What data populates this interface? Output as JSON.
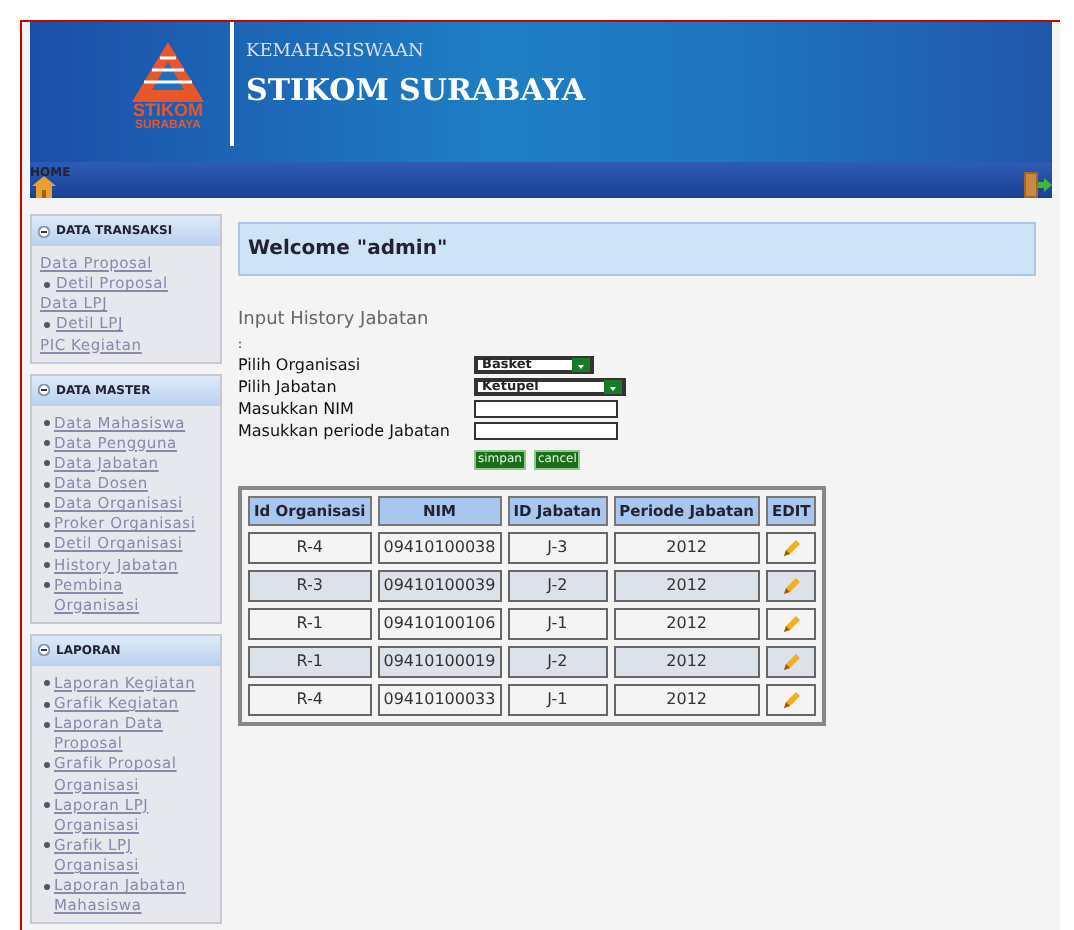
{
  "header": {
    "subtitle": "KEMAHASISWAAN",
    "title": "STIKOM SURABAYA",
    "logo_text": [
      "STIKOM",
      "SURABAYA"
    ]
  },
  "nav": {
    "home": "HOME"
  },
  "sidebar": [
    {
      "title": "DATA TRANSAKSI",
      "items": [
        {
          "label": "Data Proposal",
          "children": [
            {
              "label": "Detil Proposal"
            }
          ]
        },
        {
          "label": "Data LPJ",
          "children": [
            {
              "label": "Detil LPJ"
            }
          ]
        },
        {
          "label": "PIC Kegiatan"
        }
      ]
    },
    {
      "title": "DATA MASTER",
      "items": [
        {
          "label": "Data Mahasiswa",
          "kind": "bullet"
        },
        {
          "label": "Data Pengguna",
          "kind": "bullet"
        },
        {
          "label": "Data Jabatan",
          "kind": "bullet"
        },
        {
          "label": "Data Dosen",
          "kind": "bullet"
        },
        {
          "label": "Data Organisasi",
          "kind": "bullet"
        },
        {
          "label": "Proker Organisasi",
          "kind": "bullet"
        },
        {
          "label": "Detil Organisasi",
          "kind": "bullet"
        },
        {
          "label": "History Jabatan",
          "kind": "bullet"
        },
        {
          "label": "Pembina Organisasi",
          "kind": "bullet"
        }
      ]
    },
    {
      "title": "LAPORAN",
      "items": [
        {
          "label": "Laporan Kegiatan",
          "kind": "bullet"
        },
        {
          "label": "Grafik Kegiatan",
          "kind": "bullet"
        },
        {
          "label": "Laporan Data Proposal",
          "kind": "bullet"
        },
        {
          "label": "Grafik Proposal Organisasi",
          "kind": "bullet"
        },
        {
          "label": "Laporan LPJ Organisasi",
          "kind": "bullet"
        },
        {
          "label": "Grafik LPJ Organisasi",
          "kind": "bullet"
        },
        {
          "label": "Laporan Jabatan Mahasiswa",
          "kind": "bullet"
        }
      ]
    }
  ],
  "welcome": "Welcome \"admin\"",
  "form": {
    "title": "Input History Jabatan",
    "separator": ":",
    "fields": [
      {
        "label": "Pilih Organisasi",
        "kind": "select",
        "value": "Basket"
      },
      {
        "label": "Pilih Jabatan",
        "kind": "select",
        "value": "Ketupel"
      },
      {
        "label": "Masukkan NIM",
        "kind": "text"
      },
      {
        "label": "Masukkan periode Jabatan",
        "kind": "text"
      }
    ],
    "buttons": [
      "simpan",
      "cancel"
    ]
  },
  "table": {
    "columns": [
      "Id Organisasi",
      "NIM",
      "ID Jabatan",
      "Periode Jabatan",
      "EDIT"
    ],
    "rows": [
      [
        "R-4",
        "09410100038",
        "J-3",
        "2012"
      ],
      [
        "R-3",
        "09410100039",
        "J-2",
        "2012"
      ],
      [
        "R-1",
        "09410100106",
        "J-1",
        "2012"
      ],
      [
        "R-1",
        "09410100019",
        "J-2",
        "2012"
      ],
      [
        "R-4",
        "09410100033",
        "J-1",
        "2012"
      ]
    ]
  }
}
